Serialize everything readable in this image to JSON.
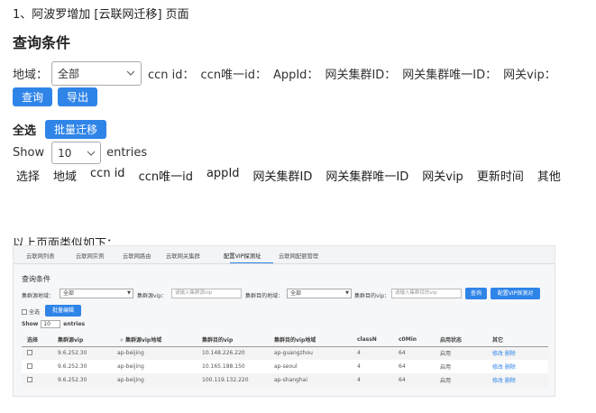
{
  "heading": "1、阿波罗增加 [云联网迁移] 页面",
  "section_title": "查询条件",
  "filter": {
    "region_label": "地域：",
    "region_value": "全部",
    "fields": [
      "ccn id：",
      "ccn唯一id：",
      "AppId：",
      "网关集群ID：",
      "网关集群唯一ID：",
      "网关vip："
    ]
  },
  "buttons": {
    "query": "查询",
    "export": "导出",
    "select_all": "全选",
    "batch_migrate": "批量迁移"
  },
  "show": {
    "prefix": "Show",
    "value": "10",
    "suffix": "entries"
  },
  "columns": [
    "选择",
    "地域",
    "ccn id",
    "ccn唯一id",
    "appId",
    "网关集群ID",
    "网关集群唯一ID",
    "网关vip",
    "更新时间",
    "其他"
  ],
  "similar_text": "以上页面类似如下：",
  "screenshot": {
    "tabs": [
      "云联网列表",
      "云联网实例",
      "云联网路由",
      "云联网关集群",
      "配置VIP探测址",
      "云联网配额管理"
    ],
    "active_tab": 4,
    "title": "查询条件",
    "filters": {
      "src_region_label": "集群源地域：",
      "src_region_value": "全部",
      "src_vip_label": "集群源vip：",
      "src_vip_placeholder": "请输入集群源vip",
      "dst_region_label": "集群目的地域：",
      "dst_region_value": "全部",
      "dst_vip_label": "集群目的vip：",
      "dst_vip_placeholder": "请输入集群目的vip",
      "query_button": "查询",
      "config_button": "配置VIP探测对"
    },
    "select_all": "全选",
    "export_button": "批量编辑",
    "show_prefix": "Show",
    "show_value": "10",
    "show_suffix": "entries",
    "columns": [
      "选择",
      "集群源vip",
      "集群源vip地域",
      "集群目的vip",
      "集群目的vip地域",
      "classN",
      "c0Min",
      "启用状态",
      "其它"
    ],
    "rows": [
      {
        "src_vip": "9.6.252.30",
        "src_region": "ap-beijing",
        "dst_vip": "10.148.226.220",
        "dst_region": "ap-guangzhou",
        "classN": "4",
        "c0Min": "64",
        "status": "启用",
        "actions": "修改 删除"
      },
      {
        "src_vip": "9.6.252.30",
        "src_region": "ap-beijing",
        "dst_vip": "10.165.188.150",
        "dst_region": "ap-seoul",
        "classN": "4",
        "c0Min": "64",
        "status": "启用",
        "actions": "修改 删除"
      },
      {
        "src_vip": "9.6.252.30",
        "src_region": "ap-beijing",
        "dst_vip": "100.119.132.220",
        "dst_region": "ap-shanghai",
        "classN": "4",
        "c0Min": "64",
        "status": "启用",
        "actions": "修改 删除"
      }
    ]
  }
}
